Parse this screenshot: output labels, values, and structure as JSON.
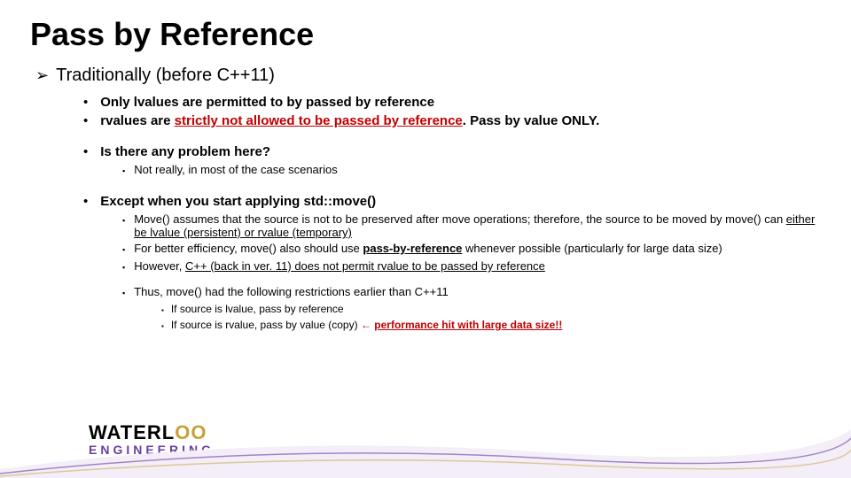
{
  "title": "Pass by Reference",
  "l1_text": "Traditionally (before C++11)",
  "b1": "Only lvalues are permitted to by passed by reference",
  "b2_pre": "rvalues are ",
  "b2_u": "strictly not allowed to be passed by reference",
  "b2_post": ".  Pass by value ONLY.",
  "b3": "Is there any problem here?",
  "b3_1": "Not really, in most of the case scenarios",
  "b4": "Except when you start applying std::move()",
  "b4_1_pre": "Move() assumes that the source is not to be preserved after move operations; therefore, the source to be moved by move() can ",
  "b4_1_u": "either be lvalue (persistent) or rvalue (temporary)",
  "b4_2_pre": "For better efficiency, move() also should use ",
  "b4_2_u": "pass-by-reference",
  "b4_2_post": " whenever possible (particularly for large data size)",
  "b4_3_pre": "However, ",
  "b4_3_u": "C++ (back in ver. 11) does not permit rvalue to be passed by reference",
  "b4_4": "Thus, move() had the following restrictions earlier than C++11",
  "b4_4_1": "If source is lvalue, pass by reference",
  "b4_4_2_pre": "If source is rvalue, pass by value (copy)  ",
  "b4_4_2_arrow": "←",
  "b4_4_2_red": "performance hit with large data size!!",
  "logo_w": "WATERL",
  "logo_oo": "OO",
  "logo_eng": "ENGINEERING"
}
